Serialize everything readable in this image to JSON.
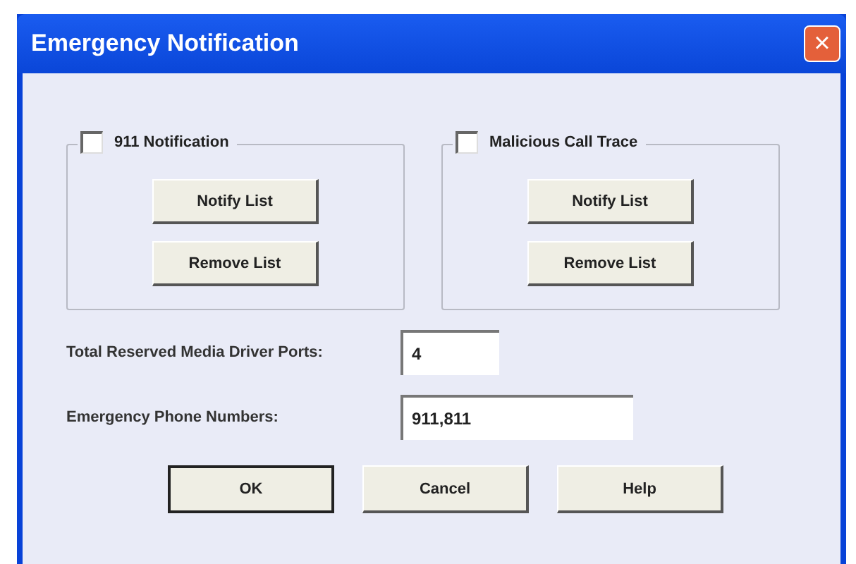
{
  "window": {
    "title": "Emergency Notification",
    "close": "×"
  },
  "groups": [
    {
      "label": "911 Notification",
      "checked": false,
      "buttons": [
        "Notify List",
        "Remove List"
      ]
    },
    {
      "label": "Malicious Call Trace",
      "checked": false,
      "buttons": [
        "Notify List",
        "Remove List"
      ]
    }
  ],
  "fields": [
    {
      "label": "Total Reserved Media Driver Ports:",
      "value": "4",
      "kind": "short"
    },
    {
      "label": "Emergency Phone Numbers:",
      "value": "911,811",
      "kind": "long"
    }
  ],
  "buttons": [
    {
      "label": "OK",
      "default": true
    },
    {
      "label": "Cancel",
      "default": false
    },
    {
      "label": "Help",
      "default": false
    }
  ]
}
